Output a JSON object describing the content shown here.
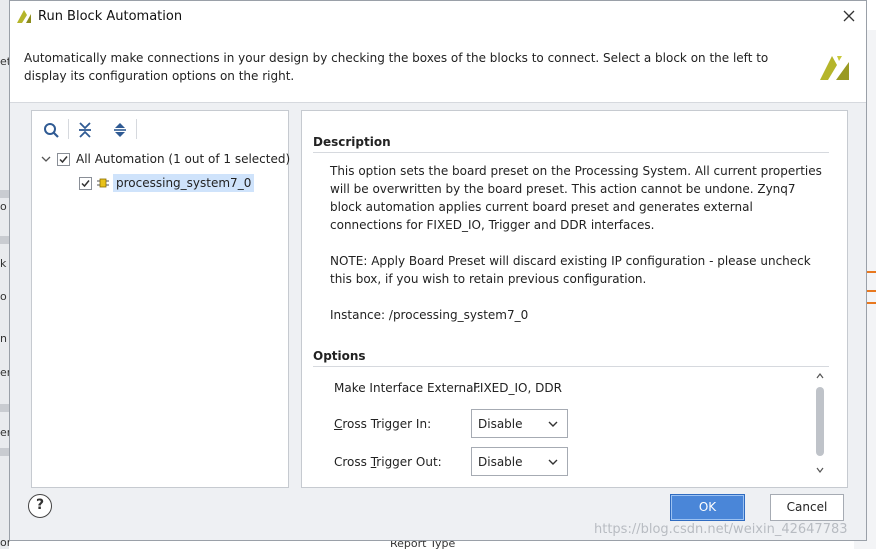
{
  "dialog": {
    "title": "Run Block Automation",
    "header_text": "Automatically make connections in your design by checking the boxes of the blocks to connect. Select a block on the left to display its configuration options on the right."
  },
  "toolbar": {
    "icons": [
      "search-icon",
      "collapse-all-icon",
      "expand-all-icon"
    ]
  },
  "tree": {
    "root": {
      "label": "All Automation (1 out of 1 selected)",
      "checked": true
    },
    "child": {
      "label": "processing_system7_0",
      "checked": true
    }
  },
  "description": {
    "title": "Description",
    "paragraph1": "This option sets the board preset on the Processing System. All current properties will be overwritten by the board preset. This action cannot be undone. Zynq7 block automation applies current board preset and generates external connections for FIXED_IO, Trigger and DDR interfaces.",
    "paragraph2": "NOTE: Apply Board Preset will discard existing IP configuration - please uncheck this box, if you wish to retain previous configuration.",
    "instance": "Instance: /processing_system7_0"
  },
  "options": {
    "title": "Options",
    "make_interface_label": "Make Interface External:",
    "make_interface_value": "FIXED_IO, DDR",
    "cross_trigger_in": {
      "label_pre": "",
      "label_u": "C",
      "label_post": "ross Trigger In:",
      "value": "Disable"
    },
    "cross_trigger_out": {
      "label_pre": "Cross ",
      "label_u": "T",
      "label_post": "rigger Out:",
      "value": "Disable"
    }
  },
  "buttons": {
    "help": "?",
    "ok": "OK",
    "cancel": "Cancel"
  },
  "watermark": "https://blog.csdn.net/weixin_42647783",
  "background": {
    "left_fragments": [
      "et",
      "o",
      "k",
      "o",
      "n",
      "er",
      "er",
      "or"
    ],
    "bottom_text": "Report Type"
  },
  "colors": {
    "accent": "#4a86d8",
    "selection": "#cfe3fb",
    "xilinx_logo": "#b5b52a"
  }
}
